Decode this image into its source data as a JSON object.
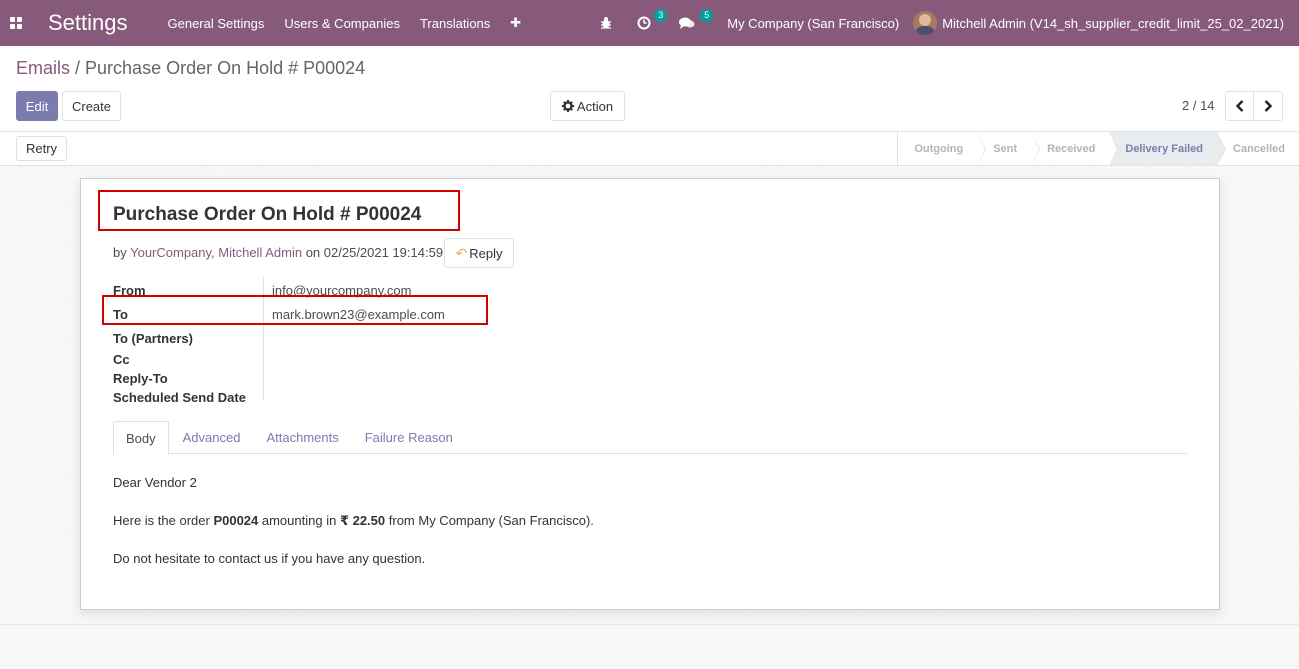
{
  "navbar": {
    "app_title": "Settings",
    "menu": [
      "General Settings",
      "Users & Companies",
      "Translations"
    ],
    "plus": "✚",
    "activity_count": "3",
    "messages_count": "5",
    "company": "My Company (San Francisco)",
    "user": "Mitchell Admin (V14_sh_supplier_credit_limit_25_02_2021)",
    "accent": "#875a7b"
  },
  "breadcrumb": {
    "parent": "Emails",
    "separator": " / ",
    "current": "Purchase Order On Hold # P00024"
  },
  "toolbar": {
    "edit_label": "Edit",
    "create_label": "Create",
    "action_label": "Action",
    "pager": "2 / 14"
  },
  "statusbar": {
    "retry_label": "Retry",
    "stages": [
      "Outgoing",
      "Sent",
      "Received",
      "Delivery Failed",
      "Cancelled"
    ],
    "active_stage": "Delivery Failed"
  },
  "email": {
    "subject": "Purchase Order On Hold # P00024",
    "by_prefix": "by ",
    "authors": "YourCompany, Mitchell Admin",
    "on_prefix": " on ",
    "date": "02/25/2021 19:14:59",
    "reply_label": "Reply",
    "fields": [
      {
        "label": "From",
        "value": "info@yourcompany.com"
      },
      {
        "label": "To",
        "value": "mark.brown23@example.com"
      },
      {
        "label": "To (Partners)",
        "value": ""
      },
      {
        "label": "Cc",
        "value": ""
      },
      {
        "label": "Reply-To",
        "value": ""
      },
      {
        "label": "Scheduled Send Date",
        "value": ""
      }
    ]
  },
  "tabs": [
    "Body",
    "Advanced",
    "Attachments",
    "Failure Reason"
  ],
  "body": {
    "greeting": "Dear Vendor 2",
    "line_prefix": "Here is the order ",
    "order_ref": "P00024",
    "line_mid": " amounting in ",
    "amount": "₹ 22.50",
    "line_suffix": " from My Company (San Francisco).",
    "closing": "Do not hesitate to contact us if you have any question."
  }
}
